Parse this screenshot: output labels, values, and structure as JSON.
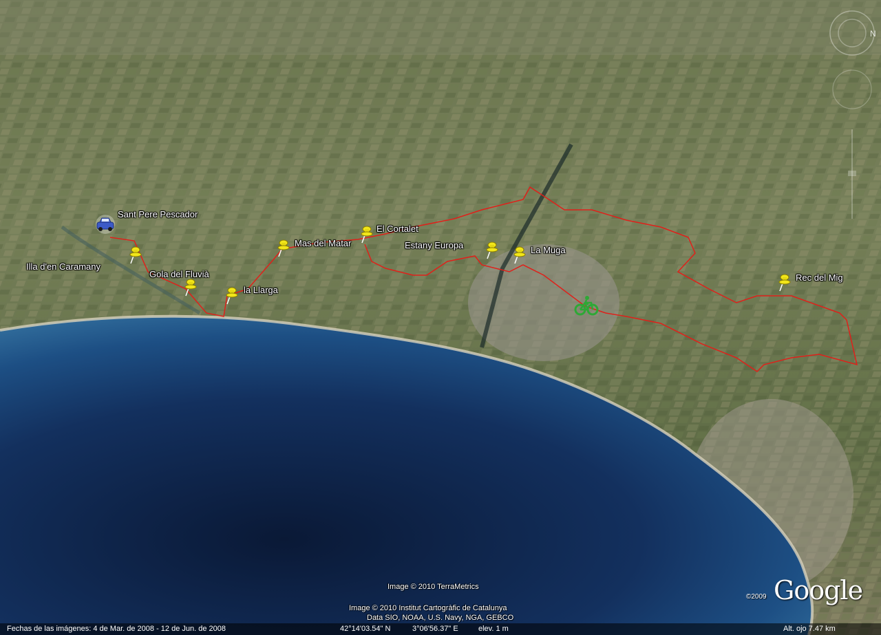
{
  "placemarks": [
    {
      "name": "Sant Pere Pescador",
      "icon": "car-icon"
    },
    {
      "name": "Illa d'en Caramany",
      "icon": "pushpin-icon"
    },
    {
      "name": "Gola del Fluvià",
      "icon": "pushpin-icon"
    },
    {
      "name": "la Llarga",
      "icon": "pushpin-icon"
    },
    {
      "name": "Mas del Matar",
      "icon": "pushpin-icon"
    },
    {
      "name": "El Cortalet",
      "icon": "pushpin-icon"
    },
    {
      "name": "Estany Europa",
      "icon": "pushpin-icon"
    },
    {
      "name": "La Muga",
      "icon": "pushpin-icon"
    },
    {
      "name": "Rec del Mig",
      "icon": "pushpin-icon"
    }
  ],
  "route": {
    "color": "#e0201a",
    "icon": "bicycle-icon",
    "icon_color": "#2ea836"
  },
  "pin_color": "#f2e61a",
  "credits": {
    "terrametrics": "Image © 2010 TerraMetrics",
    "icc": "Image © 2010 Institut Cartogràfic de Catalunya",
    "data": "Data SIO, NOAA, U.S. Navy, NGA, GEBCO"
  },
  "logo": {
    "text": "Google",
    "year": "©2009"
  },
  "status": {
    "imagery_dates": "Fechas de las imágenes:  4 de Mar. de 2008 - 12 de Jun. de 2008",
    "latitude": "42°14'03.54\" N",
    "longitude": "3°06'56.37\" E",
    "elevation": "elev.    1 m",
    "eye_altitude": "Alt. ojo    7.47 km"
  }
}
